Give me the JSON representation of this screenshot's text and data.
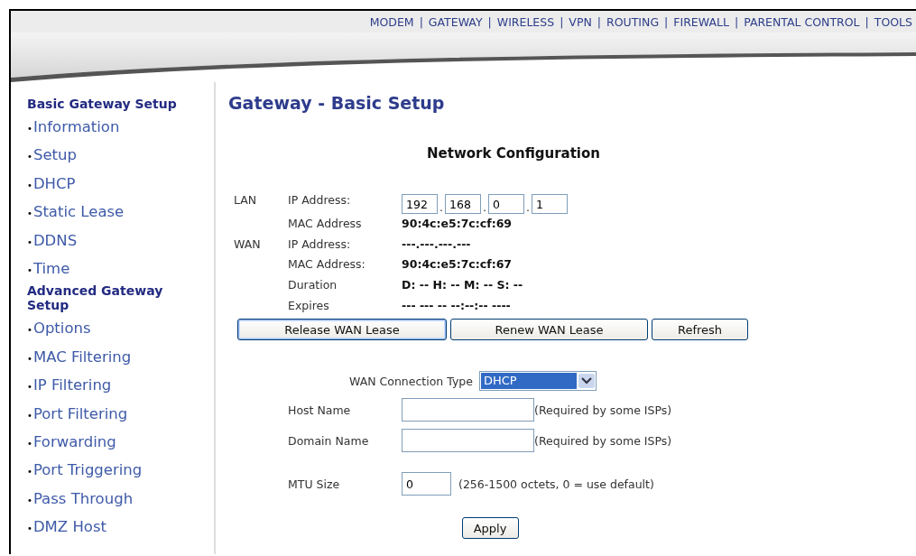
{
  "nav": {
    "separator": "|",
    "items": [
      {
        "label": "MODEM"
      },
      {
        "label": "GATEWAY"
      },
      {
        "label": "WIRELESS"
      },
      {
        "label": "VPN"
      },
      {
        "label": "ROUTING"
      },
      {
        "label": "FIREWALL"
      },
      {
        "label": "PARENTAL CONTROL"
      },
      {
        "label": "TOOLS"
      }
    ]
  },
  "sidebar": {
    "bullet": "•",
    "sections": [
      {
        "title": "Basic Gateway Setup",
        "items": [
          "Information",
          "Setup",
          "DHCP",
          "Static Lease",
          "DDNS",
          "Time"
        ]
      },
      {
        "title": "Advanced Gateway Setup",
        "items": [
          "Options",
          "MAC Filtering",
          "IP Filtering",
          "Port Filtering",
          "Forwarding",
          "Port Triggering",
          "Pass Through",
          "DMZ Host"
        ]
      }
    ]
  },
  "page_title": "Gateway - Basic Setup",
  "section_title": "Network Configuration",
  "lan": {
    "group": "LAN",
    "ip_label": "IP Address:",
    "ip_octets": [
      "192",
      "168",
      "0",
      "1"
    ],
    "ip_separator": ".",
    "mac_label": "MAC Address",
    "mac_value": "90:4c:e5:7c:cf:69"
  },
  "wan": {
    "group": "WAN",
    "ip_label": "IP Address:",
    "ip_value": "---.---.---.---",
    "mac_label": "MAC Address:",
    "mac_value": "90:4c:e5:7c:cf:67",
    "duration_label": "Duration",
    "duration_value": "D: -- H: -- M: -- S: --",
    "expires_label": "Expires",
    "expires_value": "--- --- -- --:--:-- ----"
  },
  "lease_buttons": [
    {
      "label": "Release WAN Lease",
      "focused": true
    },
    {
      "label": "Renew WAN Lease",
      "focused": false
    },
    {
      "label": "Refresh",
      "focused": false
    }
  ],
  "connection_type": {
    "label": "WAN Connection Type",
    "value": "DHCP"
  },
  "fields": [
    {
      "label": "Host Name",
      "note": "(Required by some ISPs)",
      "kind": "wide"
    },
    {
      "label": "Domain Name",
      "note": "(Required by some ISPs)",
      "kind": "wide"
    },
    {
      "label": "MTU Size",
      "value": "0",
      "note": "(256-1500 octets, 0 = use default)",
      "kind": "narrow"
    }
  ],
  "apply_button": "Apply"
}
